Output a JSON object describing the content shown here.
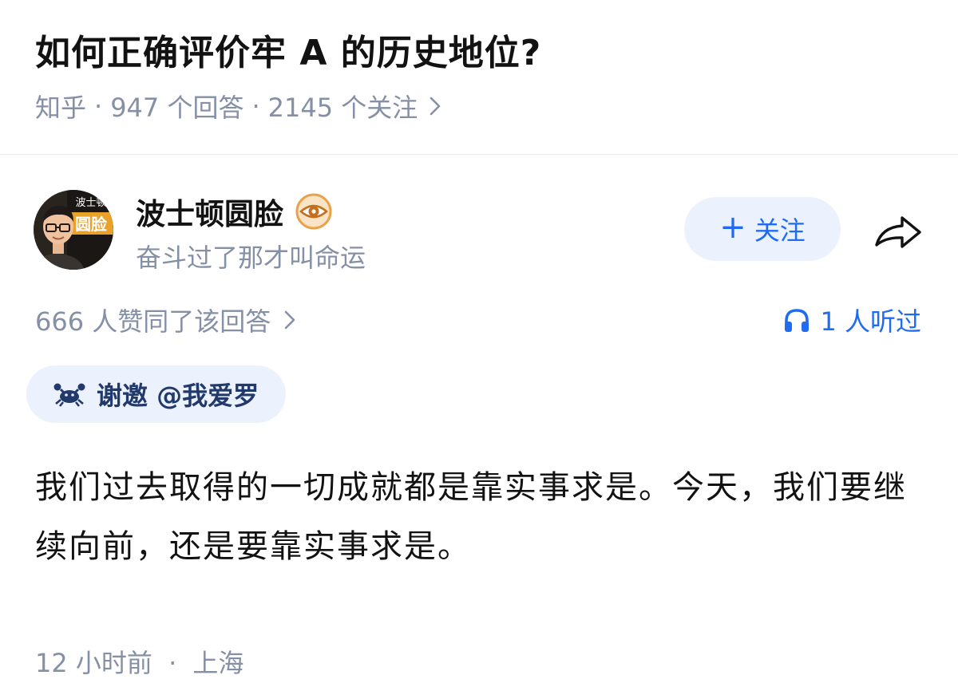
{
  "question": {
    "title": "如何正确评价牢 A 的历史地位?",
    "source": "知乎",
    "answers_count": "947 个回答",
    "followers_count": "2145 个关注",
    "separator": "·"
  },
  "author": {
    "name": "波士顿圆脸",
    "bio": "奋斗过了那才叫命运",
    "avatar_text_top": "波士顿",
    "avatar_text_main": "圆脸",
    "badge_icon": "eye-badge-icon"
  },
  "actions": {
    "follow_plus": "+",
    "follow_label": "关注",
    "share_icon": "share-arrow-icon"
  },
  "stats": {
    "upvotes_text": "666 人赞同了该回答",
    "listened_text": "1 人听过",
    "listened_icon": "headphones-icon"
  },
  "invite": {
    "text": "谢邀 @我爱罗",
    "icon": "crab-icon"
  },
  "answer": {
    "content": "我们过去取得的一切成就都是靠实事求是。今天，我们要继续向前，还是要靠实事求是。",
    "time": "12 小时前",
    "location": "上海",
    "separator": "·"
  },
  "colors": {
    "accent": "#1f6cf2",
    "muted": "#8590a6",
    "chip_background": "#ebf2fe",
    "text": "#121212"
  }
}
